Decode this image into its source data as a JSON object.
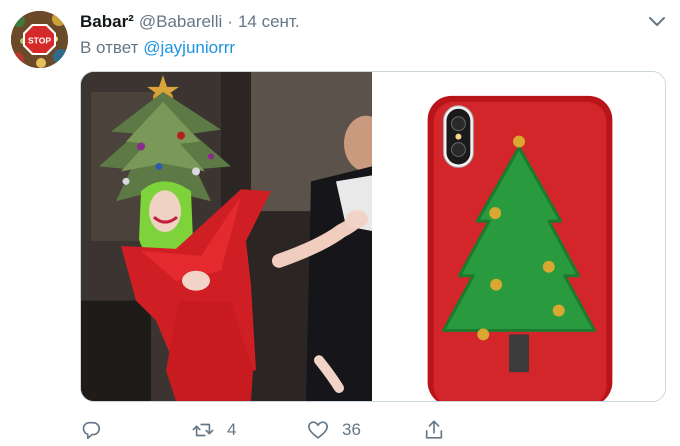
{
  "tweet": {
    "author": {
      "display_name": "Babar²",
      "handle": "@Babarelli",
      "avatar_icon": "stop-sign-avatar",
      "avatar_sign_text": "STOP"
    },
    "separator": "·",
    "date": "14 сент.",
    "reply_prefix": "В ответ",
    "reply_to": "@jayjuniorrr",
    "media": [
      {
        "icon": "christmas-tree-headdress-photo"
      },
      {
        "icon": "christmas-tree-phone-case-photo"
      }
    ],
    "actions": {
      "reply": {
        "icon": "reply-icon",
        "count": ""
      },
      "retweet": {
        "icon": "retweet-icon",
        "count": "4"
      },
      "like": {
        "icon": "heart-icon",
        "count": "36"
      },
      "share": {
        "icon": "share-icon",
        "count": ""
      }
    },
    "colors": {
      "link": "#1b95e0",
      "secondary_text": "#657786",
      "primary_text": "#14171a",
      "border": "#ccd6dd"
    }
  }
}
